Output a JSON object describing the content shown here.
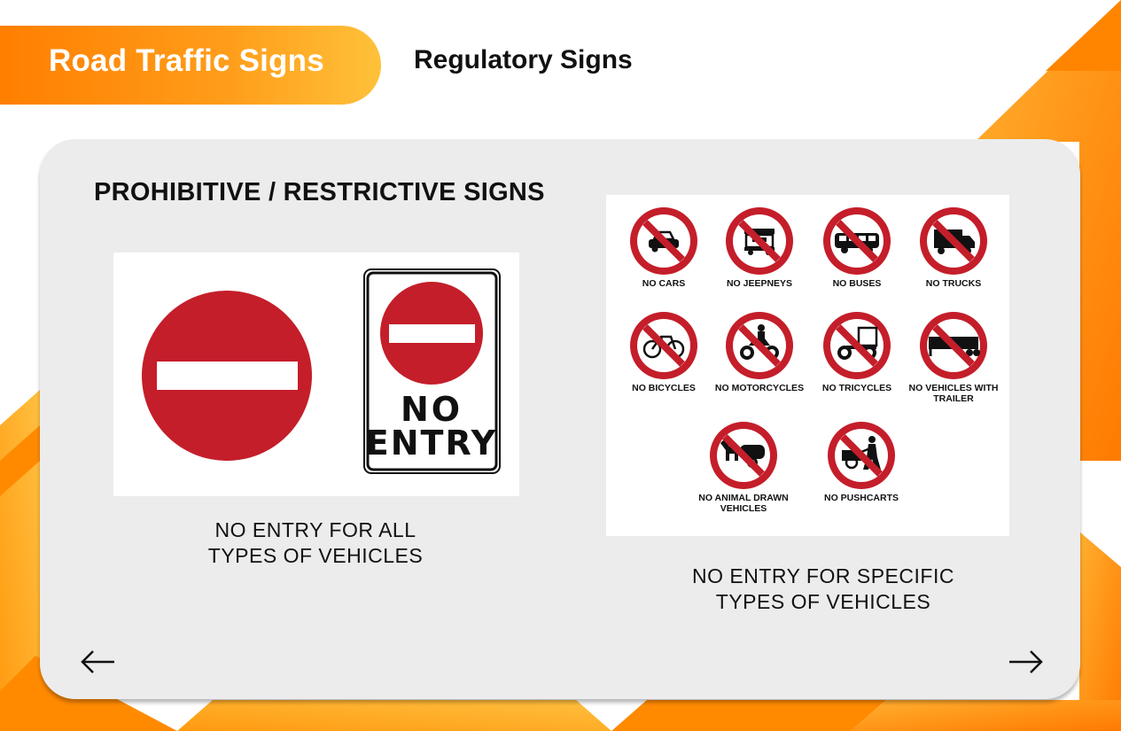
{
  "header": {
    "title": "Road Traffic Signs",
    "subtitle": "Regulatory Signs"
  },
  "section": {
    "heading": "PROHIBITIVE / RESTRICTIVE SIGNS"
  },
  "left_panel": {
    "sign_text_line1": "NO",
    "sign_text_line2": "ENTRY",
    "caption_line1": "NO ENTRY FOR ALL",
    "caption_line2": "TYPES OF VEHICLES"
  },
  "right_panel": {
    "signs": [
      {
        "label": "NO CARS",
        "icon": "car-icon"
      },
      {
        "label": "NO JEEPNEYS",
        "icon": "jeepney-icon"
      },
      {
        "label": "NO BUSES",
        "icon": "bus-icon"
      },
      {
        "label": "NO TRUCKS",
        "icon": "truck-icon"
      },
      {
        "label": "NO BICYCLES",
        "icon": "bicycle-icon"
      },
      {
        "label": "NO MOTORCYCLES",
        "icon": "motorcycle-icon"
      },
      {
        "label": "NO TRICYCLES",
        "icon": "tricycle-icon"
      },
      {
        "label": "NO VEHICLES WITH TRAILER",
        "icon": "trailer-icon"
      },
      {
        "label": "NO ANIMAL DRAWN VEHICLES",
        "icon": "animal-drawn-icon"
      },
      {
        "label": "NO PUSHCARTS",
        "icon": "pushcart-icon"
      }
    ],
    "caption_line1": "NO ENTRY FOR SPECIFIC",
    "caption_line2": "TYPES OF VEHICLES"
  },
  "navigation": {
    "prev_icon": "arrow-left-icon",
    "next_icon": "arrow-right-icon"
  },
  "colors": {
    "accent_orange": "#ff7f00",
    "accent_yellow": "#ffc13a",
    "sign_red": "#c41e2a",
    "card_bg": "#ececec"
  }
}
